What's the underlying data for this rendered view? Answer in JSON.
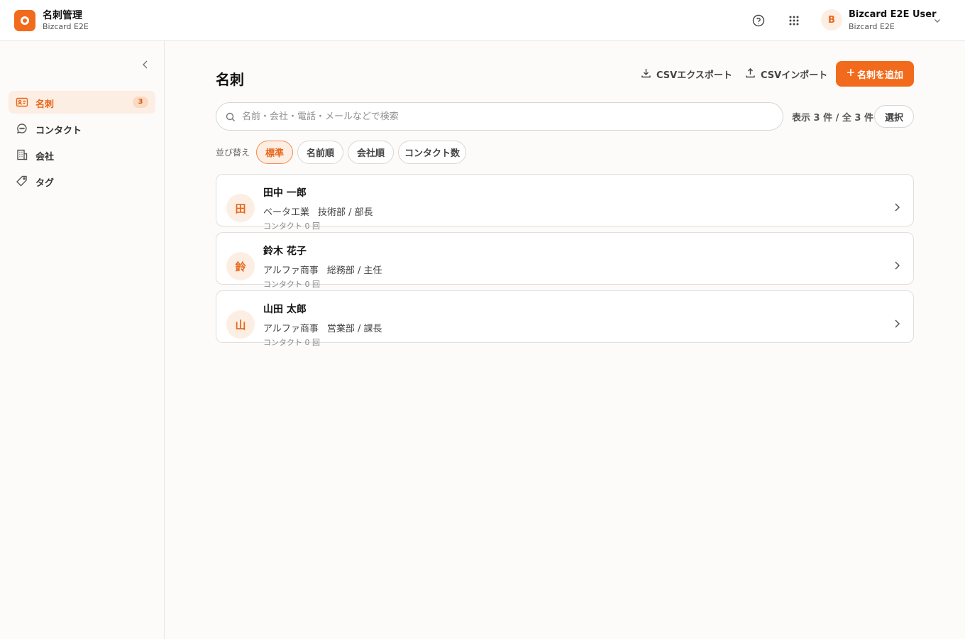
{
  "app": {
    "title": "名刺管理",
    "subtitle": "Bizcard E2E",
    "brand_color": "#f26a1b",
    "logo_icon": "bizcard-logo-icon"
  },
  "topbar": {
    "help_icon": "help-circle-icon",
    "apps_icon": "grid-icon",
    "user": {
      "initial": "B",
      "name": "Bizcard E2E User",
      "org": "Bizcard E2E"
    }
  },
  "sidebar": {
    "collapse_icon": "chevron-left-icon",
    "items": [
      {
        "label": "名刺",
        "icon": "id-card-icon",
        "badge": "3",
        "active": true
      },
      {
        "label": "コンタクト",
        "icon": "chat-bubble-icon",
        "badge": "",
        "active": false
      },
      {
        "label": "会社",
        "icon": "building-icon",
        "badge": "",
        "active": false
      },
      {
        "label": "タグ",
        "icon": "tag-icon",
        "badge": "",
        "active": false
      }
    ]
  },
  "main": {
    "title": "名刺",
    "export_label": "CSVエクスポート",
    "import_label": "CSVインポート",
    "add_label": "名刺を追加",
    "search": {
      "placeholder": "名前・会社・電話・メールなどで検索",
      "value": ""
    },
    "count_text": "表示 3 件 / 全 3 件",
    "select_label": "選択",
    "sort": {
      "label": "並び替え",
      "options": [
        "標準",
        "名前順",
        "会社順",
        "コンタクト数"
      ],
      "selected": "標準"
    },
    "cards": [
      {
        "initial": "田",
        "name": "田中 一郎",
        "company": "ベータ工業",
        "role": "技術部 / 部長",
        "contact": "コンタクト 0 回"
      },
      {
        "initial": "鈴",
        "name": "鈴木 花子",
        "company": "アルファ商事",
        "role": "総務部 / 主任",
        "contact": "コンタクト 0 回"
      },
      {
        "initial": "山",
        "name": "山田 太郎",
        "company": "アルファ商事",
        "role": "営業部 / 課長",
        "contact": "コンタクト 0 回"
      }
    ]
  }
}
